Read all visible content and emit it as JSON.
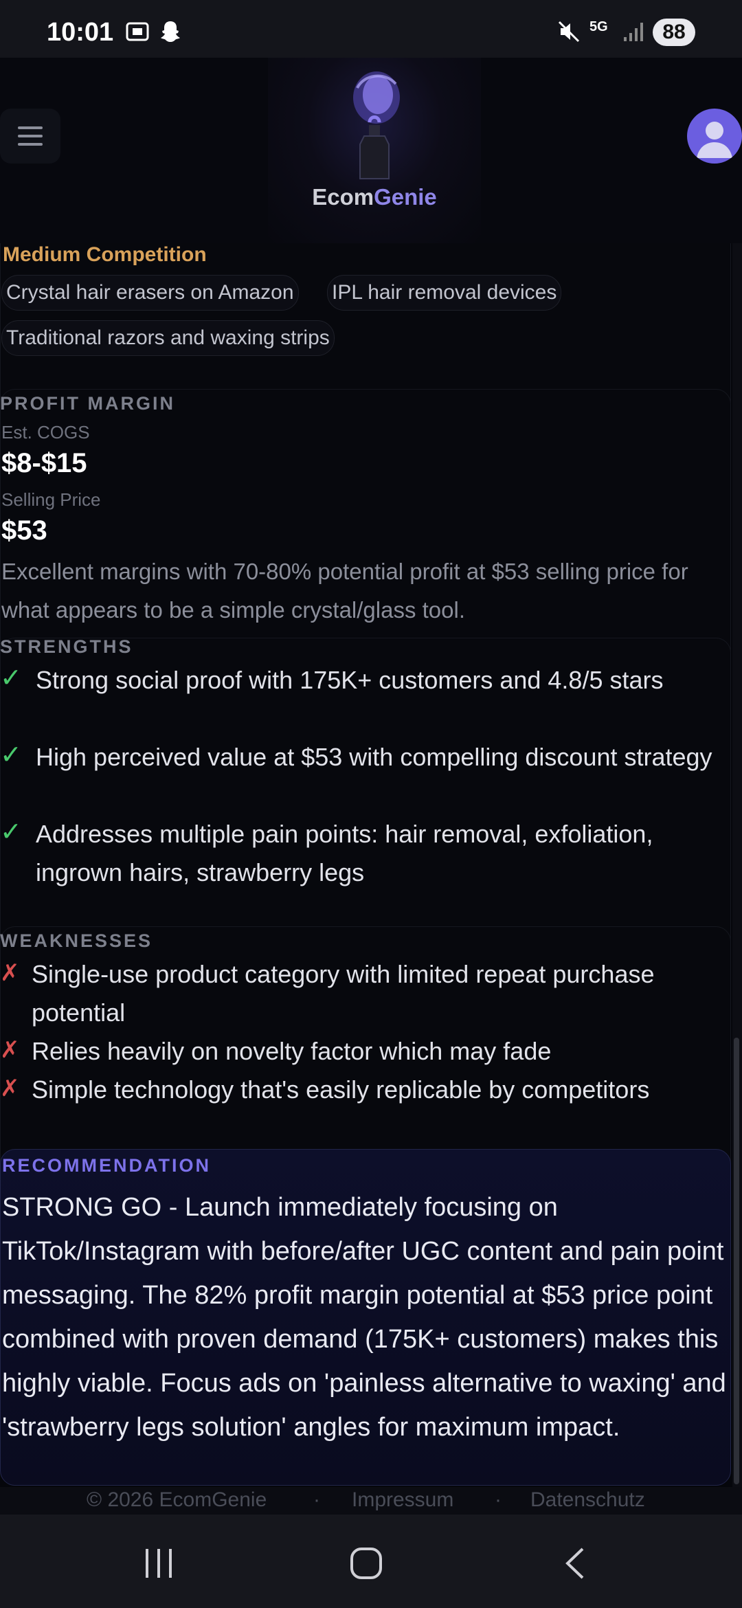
{
  "status_bar": {
    "time": "10:01",
    "battery": "88",
    "network": "5G"
  },
  "header": {
    "logo_text_part1": "Ecom",
    "logo_text_part2": "Genie",
    "accent": "#8f86e8"
  },
  "competition": {
    "level": "Medium Competition",
    "competitors": [
      "Crystal hair erasers on Amazon",
      "IPL hair removal devices",
      "Traditional razors and waxing strips"
    ]
  },
  "profit_margin": {
    "label": "PROFIT MARGIN",
    "cogs_label": "Est. COGS",
    "cogs_value": "$8-$15",
    "price_label": "Selling Price",
    "price_value": "$53",
    "note": "Excellent margins with 70-80% potential profit at $53 selling price for what appears to be a simple crystal/glass tool."
  },
  "strengths": {
    "label": "STRENGTHS",
    "items": [
      "Strong social proof with 175K+ customers and 4.8/5 stars",
      "High perceived value at $53 with compelling discount strategy",
      "Addresses multiple pain points: hair removal, exfoliation, ingrown hairs, strawberry legs"
    ]
  },
  "weaknesses": {
    "label": "WEAKNESSES",
    "items": [
      "Single-use product category with limited repeat purchase potential",
      "Relies heavily on novelty factor which may fade",
      "Simple technology that's easily replicable by competitors"
    ]
  },
  "recommendation": {
    "label": "RECOMMENDATION",
    "text": "STRONG GO - Launch immediately focusing on TikTok/Instagram with before/after UGC content and pain point messaging. The 82% profit margin potential at $53 price point combined with proven demand (175K+ customers) makes this highly viable. Focus ads on 'painless alternative to waxing' and 'strawberry legs solution' angles for maximum impact."
  },
  "footer": {
    "copyright": "© 2026 EcomGenie",
    "imprint": "Impressum",
    "privacy": "Datenschutz",
    "separator": "·"
  }
}
